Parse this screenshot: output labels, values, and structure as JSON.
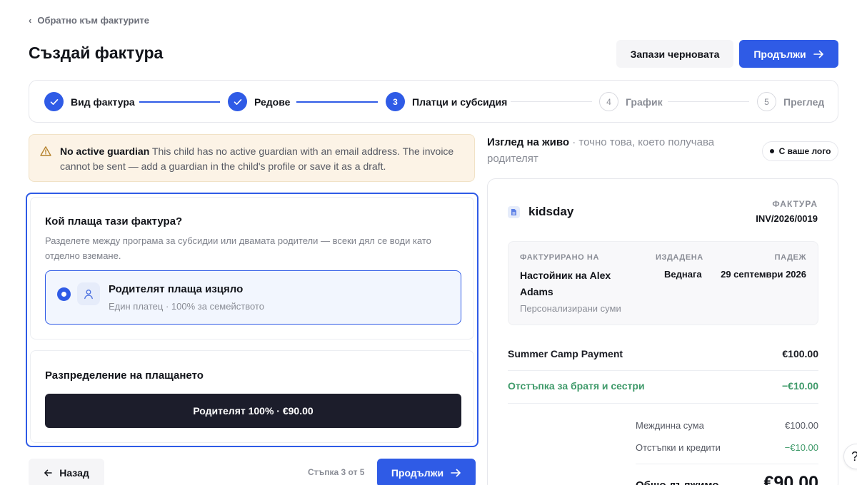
{
  "nav": {
    "back_label": "Обратно към фактурите"
  },
  "header": {
    "title": "Създай фактура",
    "save_draft_label": "Запази черновата",
    "continue_label": "Продължи"
  },
  "stepper": {
    "steps": [
      {
        "number": "1",
        "label": "Вид фактура",
        "state": "done"
      },
      {
        "number": "2",
        "label": "Редове",
        "state": "done"
      },
      {
        "number": "3",
        "label": "Платци и субсидия",
        "state": "active"
      },
      {
        "number": "4",
        "label": "График",
        "state": "todo"
      },
      {
        "number": "5",
        "label": "Преглед",
        "state": "todo"
      }
    ]
  },
  "alert": {
    "title": "No active guardian",
    "message": "This child has no active guardian with an email address. The invoice cannot be sent — add a guardian in the child's profile or save it as a draft."
  },
  "payer": {
    "heading": "Кой плаща тази фактура?",
    "description": "Разделете между програма за субсидии или двамата родители — всеки дял се води като отделно вземане.",
    "option": {
      "title": "Родителят плаща изцяло",
      "subtitle": "Един платец · 100% за семейството",
      "selected": true
    }
  },
  "distribution": {
    "heading": "Разпределение на плащането",
    "bar_label": "Родителят 100% · €90.00",
    "share_percent": 100
  },
  "footer": {
    "back_label": "Назад",
    "step_counter": "Стъпка 3 от 5",
    "continue_label": "Продължи"
  },
  "preview": {
    "title": "Изглед на живо",
    "subtitle": "· точно това, което получава родителят",
    "logo_badge": "С ваше лого",
    "invoice": {
      "brand": "kidsday",
      "type_label": "ФАКТУРА",
      "number": "INV/2026/0019",
      "billed_to_caption": "ФАКТУРИРАНО НА",
      "billed_to_name": "Настойник на Alex Adams",
      "billed_to_sub": "Персонализирани суми",
      "issued_caption": "ИЗДАДЕНА",
      "issued_value": "Веднага",
      "due_caption": "ПАДЕЖ",
      "due_value": "29 септември 2026",
      "lines": [
        {
          "label": "Summer Camp Payment",
          "amount": "€100.00",
          "kind": "normal"
        },
        {
          "label": "Отстъпка за братя и сестри",
          "amount": "−€10.00",
          "kind": "discount"
        }
      ],
      "subtotal_label": "Междинна сума",
      "subtotal_value": "€100.00",
      "discounts_label": "Отстъпки и кредити",
      "discounts_value": "−€10.00",
      "total_label": "Общо дължимо",
      "total_value": "€90.00"
    }
  },
  "help": {
    "label": "?"
  },
  "colors": {
    "accent": "#2f5be6",
    "dark": "#1c1d2b",
    "success": "#3f9a6a",
    "warning_bg": "#fcf3e6"
  }
}
